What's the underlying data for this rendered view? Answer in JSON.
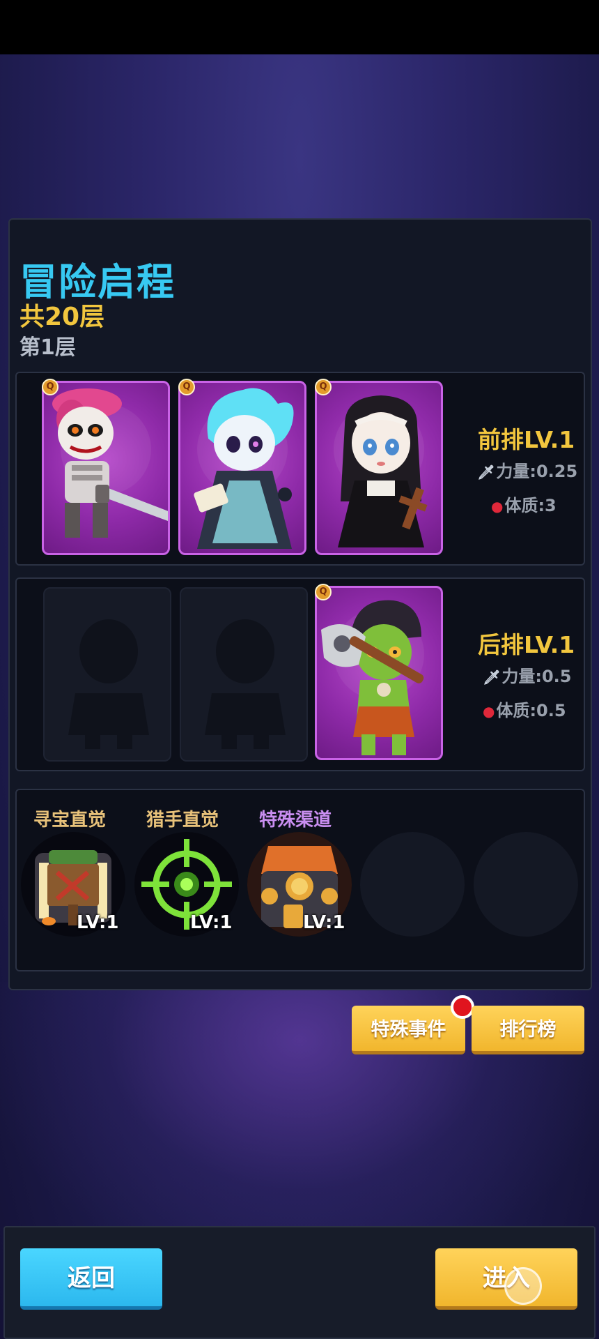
{
  "header": {
    "title": "冒险启程",
    "total_floors": "共20层",
    "current_floor": "第1层"
  },
  "front_row": {
    "label": "前排LV.1",
    "strength": "力量:0.25",
    "constitution": "体质:3",
    "heroes": [
      {
        "name": "pink-hair-skeleton-swordsman",
        "badge": "Q"
      },
      {
        "name": "blue-flame-ghost-mage",
        "badge": "Q"
      },
      {
        "name": "nun-healer",
        "badge": "Q"
      }
    ]
  },
  "back_row": {
    "label": "后排LV.1",
    "strength": "力量:0.5",
    "constitution": "体质:0.5",
    "heroes": [
      {
        "name": "green-orc-axe-warrior",
        "badge": "Q"
      }
    ]
  },
  "skills": [
    {
      "name": "寻宝直觉",
      "level": "LV:1",
      "icon": "treasure-sign-icon"
    },
    {
      "name": "猎手直觉",
      "level": "LV:1",
      "icon": "crosshair-icon"
    },
    {
      "name": "特殊渠道",
      "level": "LV:1",
      "icon": "coin-chest-icon"
    }
  ],
  "buttons": {
    "special_event": "特殊事件",
    "leaderboard": "排行榜",
    "back": "返回",
    "enter": "进入"
  },
  "colors": {
    "title": "#37c9f2",
    "gold": "#f2c63e",
    "card_purple": "#8e2aa8",
    "button_yellow": "#f1b62d",
    "button_blue": "#2cb8ee"
  }
}
